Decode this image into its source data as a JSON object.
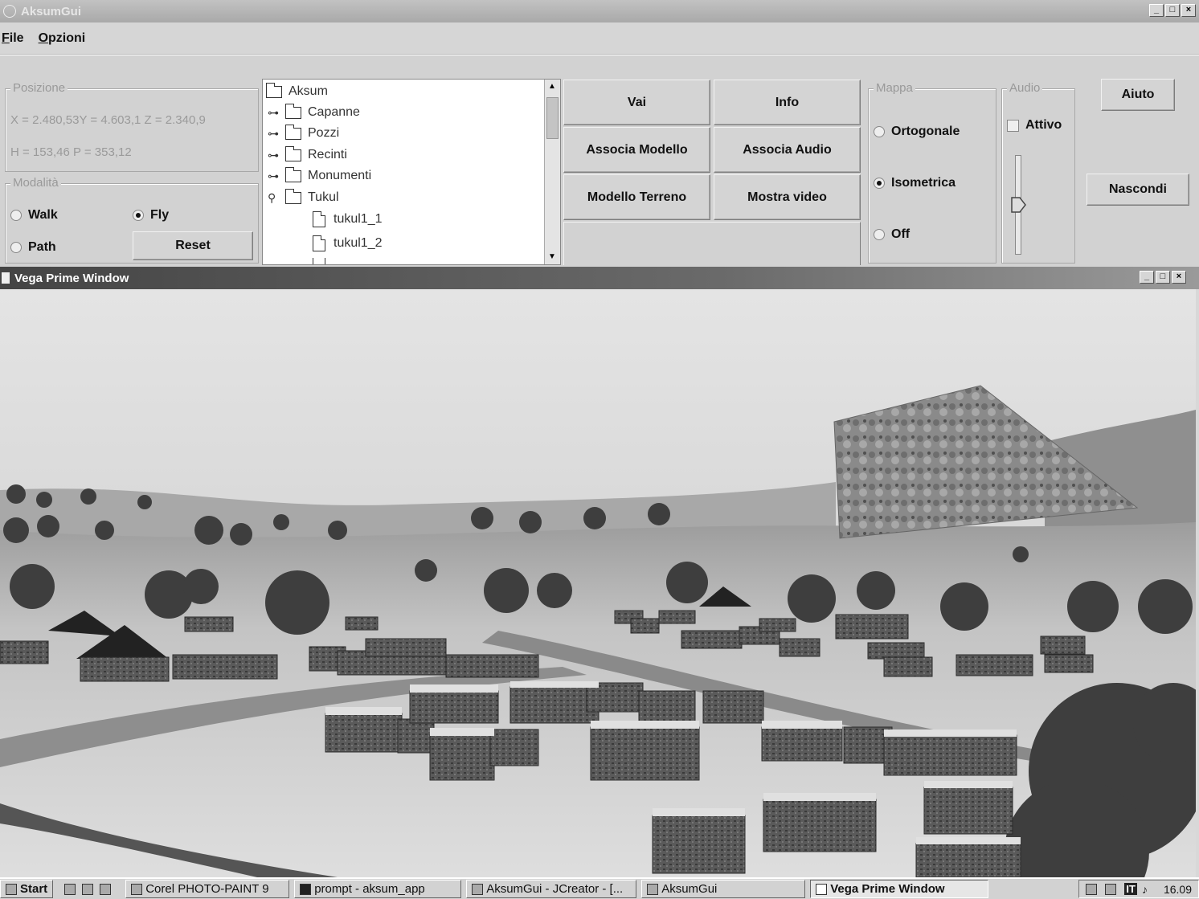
{
  "app": {
    "title": "AksumGui",
    "window_buttons": [
      "_",
      "□",
      "×"
    ]
  },
  "menu": {
    "file": "File",
    "options": "Opzioni"
  },
  "posizione": {
    "label": "Posizione",
    "line1": "X = 2.480,53Y = 4.603,1  Z = 2.340,9",
    "line2": "H = 153,46   P = 353,12"
  },
  "modalita": {
    "label": "Modalità",
    "walk": "Walk",
    "fly": "Fly",
    "path": "Path",
    "selected": "Fly",
    "reset": "Reset"
  },
  "tree": {
    "root": "Aksum",
    "items": [
      {
        "label": "Capanne"
      },
      {
        "label": "Pozzi"
      },
      {
        "label": "Recinti"
      },
      {
        "label": "Monumenti"
      },
      {
        "label": "Tukul"
      }
    ],
    "children": [
      "tukul1_1",
      "tukul1_2"
    ]
  },
  "actions": {
    "vai": "Vai",
    "info": "Info",
    "associa_modello": "Associa Modello",
    "associa_audio": "Associa Audio",
    "modello_terreno": "Modello Terreno",
    "mostra_video": "Mostra video"
  },
  "mappa": {
    "label": "Mappa",
    "ortogonale": "Ortogonale",
    "isometrica": "Isometrica",
    "off": "Off",
    "selected": "Isometrica"
  },
  "audio": {
    "label": "Audio",
    "attivo": "Attivo",
    "checked": false
  },
  "side_buttons": {
    "aiuto": "Aiuto",
    "nascondi": "Nascondi"
  },
  "vega": {
    "title": "Vega Prime Window"
  },
  "taskbar": {
    "start": "Start",
    "items": [
      {
        "label": "Corel PHOTO-PAINT 9",
        "active": false
      },
      {
        "label": "prompt - aksum_app",
        "active": false
      },
      {
        "label": "AksumGui - JCreator - [...",
        "active": false
      },
      {
        "label": "AksumGui",
        "active": false
      },
      {
        "label": "Vega Prime Window",
        "active": true
      }
    ],
    "tray_lang": "IT",
    "clock": "16.09"
  },
  "colors": {
    "sky_top": "#e2e2e2",
    "sky_bottom": "#c9c9c9",
    "ground": "#d8d8d8",
    "title_dark": "#444444"
  }
}
